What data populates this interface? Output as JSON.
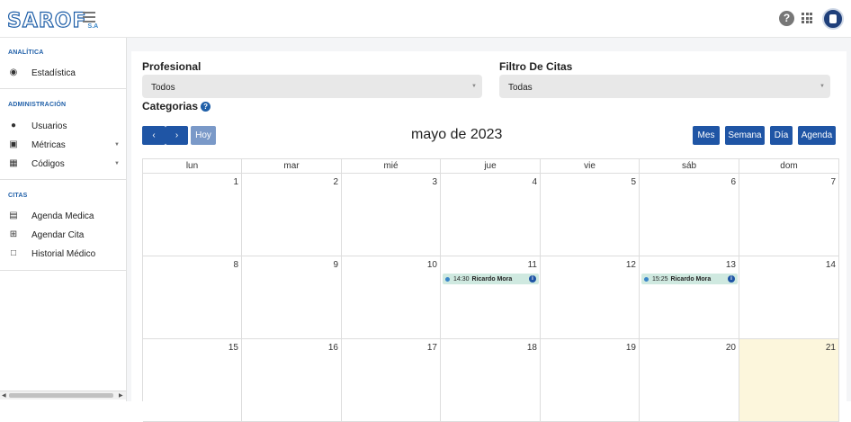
{
  "app": {
    "logo_text": "SAROF",
    "logo_sub": "S.A"
  },
  "header": {
    "help_icon": "help-circle-icon",
    "apps_icon": "apps-grid-icon",
    "avatar_icon": "user-avatar"
  },
  "sidebar": {
    "sections": [
      {
        "title": "ANALÍTICA",
        "items": [
          {
            "label": "Estadística",
            "icon": "dashboard-icon"
          }
        ]
      },
      {
        "title": "ADMINISTRACIÓN",
        "items": [
          {
            "label": "Usuarios",
            "icon": "person-icon"
          },
          {
            "label": "Métricas",
            "icon": "inbox-icon",
            "caret": true
          },
          {
            "label": "Códigos",
            "icon": "grid-list-icon",
            "caret": true
          }
        ]
      },
      {
        "title": "CITAS",
        "items": [
          {
            "label": "Agenda Medica",
            "icon": "calendar-icon"
          },
          {
            "label": "Agendar Cita",
            "icon": "add-box-icon"
          },
          {
            "label": "Historial Médico",
            "icon": "folder-icon"
          }
        ]
      }
    ]
  },
  "filters": {
    "profesional_label": "Profesional",
    "profesional_value": "Todos",
    "citas_label": "Filtro De Citas",
    "citas_value": "Todas",
    "categorias_label": "Categorias"
  },
  "calendar": {
    "prev_icon": "chevron-left-icon",
    "next_icon": "chevron-right-icon",
    "today_label": "Hoy",
    "title": "mayo de 2023",
    "views": [
      "Mes",
      "Semana",
      "Día",
      "Agenda"
    ],
    "weekdays": [
      "lun",
      "mar",
      "mié",
      "jue",
      "vie",
      "sáb",
      "dom"
    ],
    "weeks": [
      [
        "1",
        "2",
        "3",
        "4",
        "5",
        "6",
        "7"
      ],
      [
        "8",
        "9",
        "10",
        "11",
        "12",
        "13",
        "14"
      ],
      [
        "15",
        "16",
        "17",
        "18",
        "19",
        "20",
        "21"
      ]
    ],
    "today": "21",
    "events": [
      {
        "day": "11",
        "time": "14:30",
        "name": "Ricardo Mora"
      },
      {
        "day": "13",
        "time": "15:25",
        "name": "Ricardo Mora"
      }
    ],
    "colors": {
      "primary": "#1f55a5",
      "event_bg": "#cfe9e0",
      "today_bg": "#fcf6dc"
    }
  }
}
